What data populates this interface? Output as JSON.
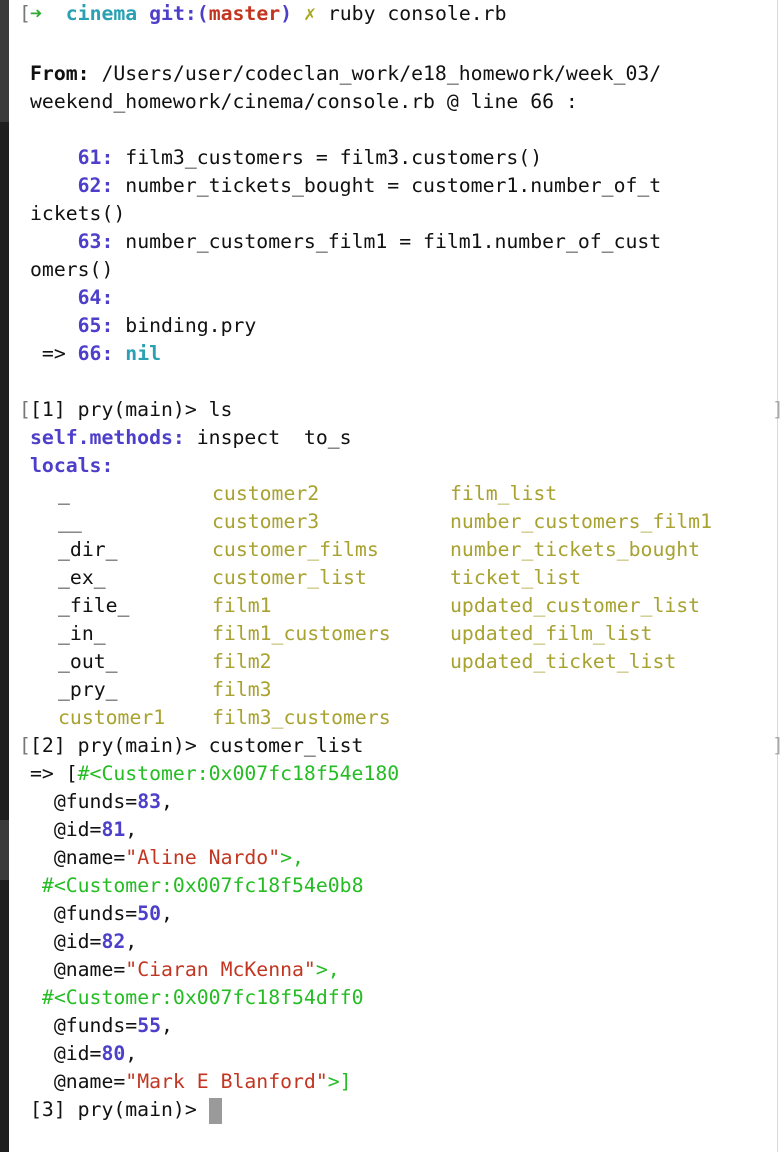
{
  "prompt": {
    "arrow": "➜",
    "dir": "cinema",
    "git_prefix": "git:(",
    "branch": "master",
    "git_suffix": ")",
    "dirty_mark": "✗",
    "command": "ruby console.rb"
  },
  "from_label": "From:",
  "from_path_1": "/Users/user/codeclan_work/e18_homework/week_03/",
  "from_path_2": "weekend_homework/cinema/console.rb @ line 66 :",
  "code_lines": [
    {
      "num": "61:",
      "text": "film3_customers = film3.customers()"
    },
    {
      "num": "62:",
      "text": "number_tickets_bought = customer1.number_of_t"
    },
    {
      "cont": "ickets()"
    },
    {
      "num": "63:",
      "text": "number_customers_film1 = film1.number_of_cust"
    },
    {
      "cont": "omers()"
    },
    {
      "num": "64:",
      "text": ""
    },
    {
      "num": "65:",
      "text": "binding.pry"
    }
  ],
  "current_line": {
    "marker": " => ",
    "num": "66:",
    "text": "nil"
  },
  "pry1": {
    "prompt": "[1] pry(main)> ",
    "command": "ls"
  },
  "self_methods": {
    "label": "self.methods:",
    "value": "inspect  to_s"
  },
  "locals_label": "locals:",
  "locals_col1": [
    "_",
    "__",
    "_dir_",
    "_ex_",
    "_file_",
    "_in_",
    "_out_",
    "_pry_",
    "customer1"
  ],
  "locals_col2": [
    "customer2",
    "customer3",
    "customer_films",
    "customer_list",
    "film1",
    "film1_customers",
    "film2",
    "film3",
    "film3_customers"
  ],
  "locals_col3": [
    "film_list",
    "number_customers_film1",
    "number_tickets_bought",
    "ticket_list",
    "updated_customer_list",
    "updated_film_list",
    "updated_ticket_list"
  ],
  "pry2": {
    "prompt": "[2] pry(main)> ",
    "command": "customer_list"
  },
  "result_prefix": "=> [",
  "customers": [
    {
      "obj": "#<Customer:0x007fc18f54e180",
      "funds": "83",
      "id": "81",
      "name": "\"Aline Nardo\"",
      "close": ">,"
    },
    {
      "obj": "#<Customer:0x007fc18f54e0b8",
      "funds": "50",
      "id": "82",
      "name": "\"Ciaran McKenna\"",
      "close": ">,"
    },
    {
      "obj": "#<Customer:0x007fc18f54dff0",
      "funds": "55",
      "id": "80",
      "name": "\"Mark E Blanford\"",
      "close": ">]"
    }
  ],
  "attrs": {
    "funds": "@funds=",
    "id": "@id=",
    "name": "@name=",
    "comma": ","
  },
  "pry3": {
    "prompt": "[3] pry(main)> "
  },
  "colors": {
    "background": "#ffffff",
    "green": "#2eab30",
    "cyan": "#2aa1b3",
    "red": "#c23621",
    "purple": "#4d3fc9",
    "olive": "#a8a230",
    "object_green": "#25bc24"
  }
}
